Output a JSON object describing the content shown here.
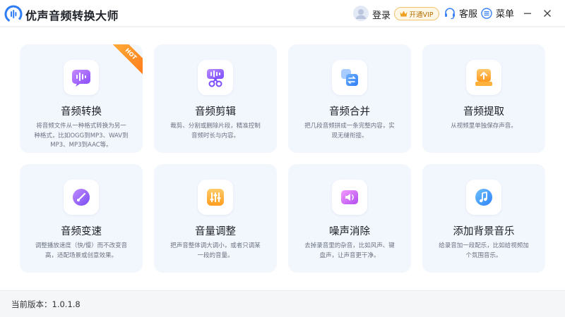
{
  "app": {
    "title": "优声音频转换大师",
    "login_label": "登录",
    "vip_label": "开通VIP",
    "service_label": "客服",
    "menu_label": "菜单"
  },
  "colors": {
    "accent": "#3b82f6",
    "vip": "#f0a020",
    "card_bg": "#f2f6fd"
  },
  "cards": [
    {
      "title": "音频转换",
      "desc": "将音频文件从一种格式转换为另一种格式，比如OGG到MP3、WAV到MP3、MP3到AAC等。",
      "icon": "audio-convert-icon",
      "badge": "HOT"
    },
    {
      "title": "音频剪辑",
      "desc": "裁剪、分割或删除片段，精准控制音频时长与内容。",
      "icon": "audio-cut-icon"
    },
    {
      "title": "音频合并",
      "desc": "把几段音频拼成一条完整内容，实现无缝衔接。",
      "icon": "audio-merge-icon"
    },
    {
      "title": "音频提取",
      "desc": "从视频里单独保存声音。",
      "icon": "audio-extract-icon"
    },
    {
      "title": "音频变速",
      "desc": "调整播放速度（快/慢）而不改变音高，适配场景或创意效果。",
      "icon": "audio-speed-icon"
    },
    {
      "title": "音量调整",
      "desc": "把声音整体调大调小，或者只调某一段的音量。",
      "icon": "volume-adjust-icon"
    },
    {
      "title": "噪声消除",
      "desc": "去掉录音里的杂音，比如风声、键盘声，让声音更干净。",
      "icon": "noise-removal-icon"
    },
    {
      "title": "添加背景音乐",
      "desc": "给录音加一段配乐，比如给视频加个氛围音乐。",
      "icon": "background-music-icon"
    }
  ],
  "footer": {
    "version": "当前版本：1.0.1.8"
  }
}
